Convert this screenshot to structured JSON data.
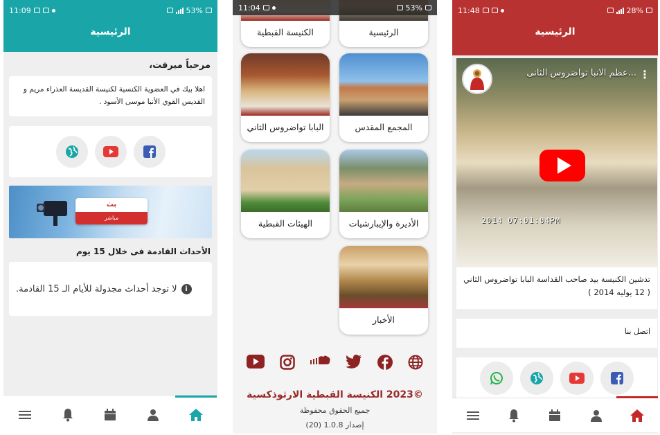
{
  "screen1": {
    "status": {
      "time": "11:09",
      "battery": "53%"
    },
    "header_title": "الرئيسية",
    "greeting": "مرحباً ميرفت،",
    "welcome_text": "اهلا بيك في العضوية الكنسية لكنيسة القديسة العذراء مريم و القديس القوي الأنبا موسى الأسود .",
    "live": {
      "title": "بث",
      "subtitle": "مباشر"
    },
    "events_title": "الأحداث القادمة فى خلال 15 يوم",
    "no_events": "لا توجد أحداث مجدولة للأيام الـ 15 القادمة.",
    "accent": "#1aa5a8"
  },
  "screen2": {
    "status": {
      "time": "11:04",
      "battery": "53%"
    },
    "tiles": [
      {
        "label": "الرئيسية"
      },
      {
        "label": "الكنيسة القبطية"
      },
      {
        "label": "المجمع المقدس"
      },
      {
        "label": "البابا تواضروس الثاني"
      },
      {
        "label": "الأديرة والإيبارشيات"
      },
      {
        "label": "الهيئات القبطية"
      },
      {
        "label": "الأخبار"
      }
    ],
    "copyright": "©2023 الكنيسة القبطية الارثوذكسية",
    "rights": "جميع الحقوق محفوظة",
    "version": "إصدار 1.0.8 (20)"
  },
  "screen3": {
    "status": {
      "time": "11:48",
      "battery": "28%"
    },
    "header_title": "الرئيسية",
    "video_title": "...عظم الانبا تواضروس الثانى",
    "video_stamp": "2014 07:01:04PM",
    "video_description": "تدشين الكنيسة بيد صاحب القداسة البابا تواضروس الثاني ( 12 يوليه 2014 )",
    "contact": "اتصل بنا",
    "accent": "#b83232"
  }
}
